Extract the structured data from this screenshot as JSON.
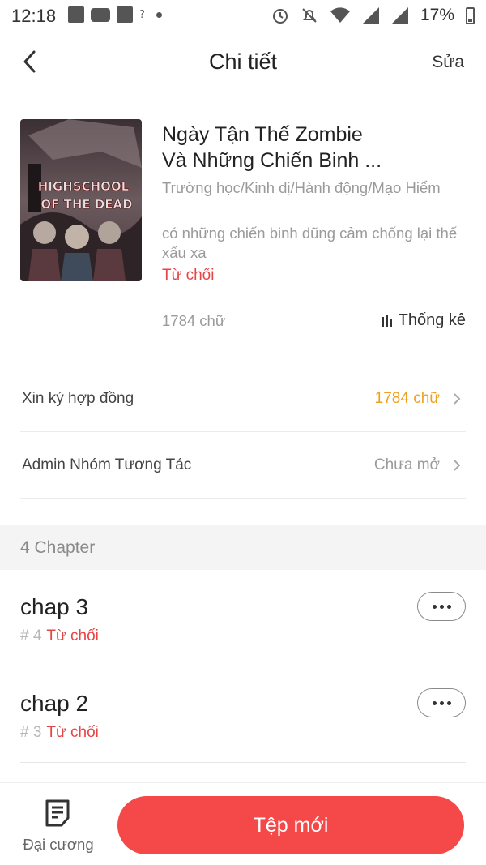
{
  "status_bar": {
    "time": "12:18",
    "signal_label": "?",
    "battery_percent": "17%"
  },
  "header": {
    "title": "Chi tiết",
    "edit_label": "Sửa",
    "back_icon": "chevron-left-icon"
  },
  "book": {
    "title_line1": "Ngày Tận Thế Zombie",
    "title_line2": "Và Những Chiến Binh ...",
    "genres": "Trường học/Kinh dị/Hành động/Mạo Hiểm",
    "description": "có những chiến binh dũng cảm chống lại thế xấu xa",
    "status": "Từ chối",
    "word_count": "1784 chữ",
    "stats_label": "Thống kê",
    "cover_text_1": "HIGHSCHOOL",
    "cover_text_2": "OF THE DEAD"
  },
  "rows": [
    {
      "label": "Xin ký hợp đồng",
      "value": "1784 chữ",
      "value_color": "#f0a020"
    },
    {
      "label": "Admin Nhóm Tương Tác",
      "value": "Chưa mở",
      "value_color": "#9a9a9a"
    }
  ],
  "chapters_section": {
    "count_label": "4 Chapter"
  },
  "chapters": [
    {
      "name": "chap 3",
      "number": "# 4",
      "status": "Từ chối"
    },
    {
      "name": "chap 2",
      "number": "# 3",
      "status": "Từ chối"
    }
  ],
  "bottom": {
    "outline_label": "Đại cương",
    "new_button_label": "Tệp mới"
  },
  "colors": {
    "accent_red": "#f54848",
    "status_red": "#e64545",
    "orange": "#f0a020"
  }
}
